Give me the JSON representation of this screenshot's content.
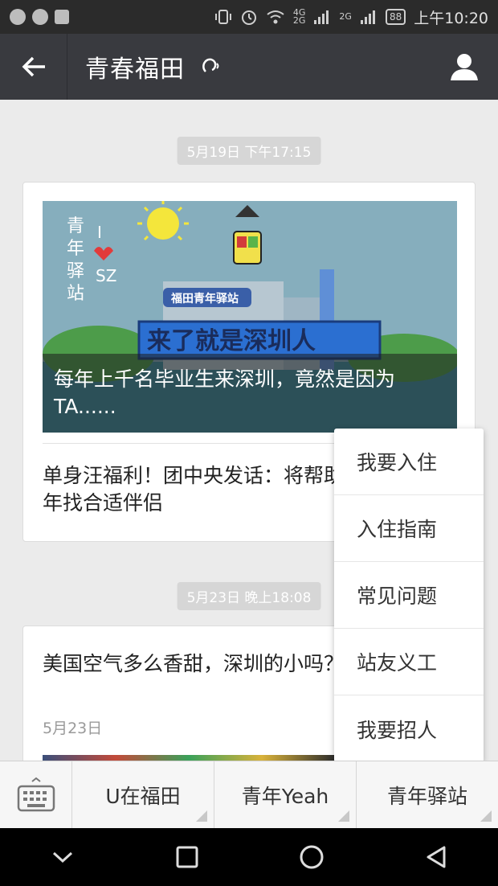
{
  "status_bar": {
    "sim_labels": [
      "4G",
      "2G"
    ],
    "sim2_label": "2G",
    "battery": "88",
    "time": "上午10:20"
  },
  "header": {
    "title": "青春福田",
    "back_icon": "arrow-left-icon",
    "earpiece_icon": "ear-icon",
    "profile_icon": "person-icon"
  },
  "messages": [
    {
      "timestamp": "5月19日 下午17:15",
      "cover_caption": "每年上千名毕业生来深圳，竟然是因为TA......",
      "cover_texts": {
        "vertical": "青年驿站",
        "slogan_i": "I",
        "slogan_sz": "SZ",
        "building_sign": "福田青年驿站",
        "banner": "来了就是深圳人"
      },
      "article_title": "单身汪福利！团中央发话：将帮助大龄未婚青年找合适伴侣"
    },
    {
      "timestamp": "5月23日 晚上18:08",
      "article_title": "美国空气多么香甜，深圳的小吗？",
      "date": "5月23日"
    }
  ],
  "popup_menu": {
    "items": [
      "我要入住",
      "入住指南",
      "常见问题",
      "站友义工",
      "我要招人"
    ]
  },
  "bottom_menu": {
    "keyboard_icon": "keyboard-icon",
    "tabs": [
      "U在福田",
      "青年Yeah",
      "青年驿站"
    ]
  },
  "nav_bar": {
    "icons": [
      "chevron-down-icon",
      "recents-square-icon",
      "home-circle-icon",
      "back-triangle-icon"
    ]
  }
}
